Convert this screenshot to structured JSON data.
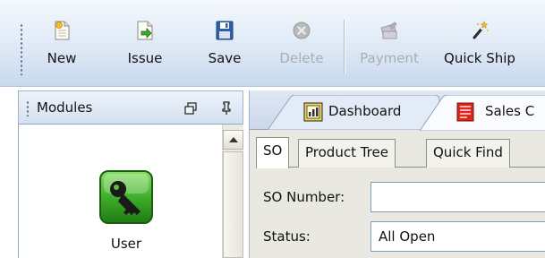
{
  "toolbar": {
    "buttons": [
      {
        "label": "New",
        "icon": "new-document-icon",
        "enabled": true
      },
      {
        "label": "Issue",
        "icon": "issue-document-icon",
        "enabled": true
      },
      {
        "label": "Save",
        "icon": "floppy-disk-icon",
        "enabled": true
      },
      {
        "label": "Delete",
        "icon": "delete-icon",
        "enabled": false
      },
      {
        "label": "Payment",
        "icon": "payment-icon",
        "enabled": false
      },
      {
        "label": "Quick Ship",
        "icon": "magic-wand-icon",
        "enabled": true
      }
    ]
  },
  "modules": {
    "title": "Modules",
    "items": [
      {
        "label": "User",
        "icon": "key-icon"
      }
    ]
  },
  "document_tabs": [
    {
      "label": "Dashboard",
      "icon": "dashboard-icon",
      "active": false
    },
    {
      "label": "Sales C",
      "icon": "sales-order-icon",
      "active": true
    }
  ],
  "so_tabs": [
    {
      "label": "SO",
      "active": true
    },
    {
      "label": "Product Tree",
      "active": false
    },
    {
      "label": "Quick Find",
      "active": false
    }
  ],
  "form": {
    "so_number": {
      "label": "SO Number:",
      "value": ""
    },
    "status": {
      "label": "Status:",
      "value": "All Open"
    }
  },
  "colors": {
    "toolbar_top": "#f4f8fd",
    "toolbar_bottom": "#c8d8ee",
    "panel_border": "#8ea6c7",
    "disabled_text": "#a8acb4",
    "user_icon_green": "#3fae2a",
    "sales_tab_red": "#d8281c"
  }
}
